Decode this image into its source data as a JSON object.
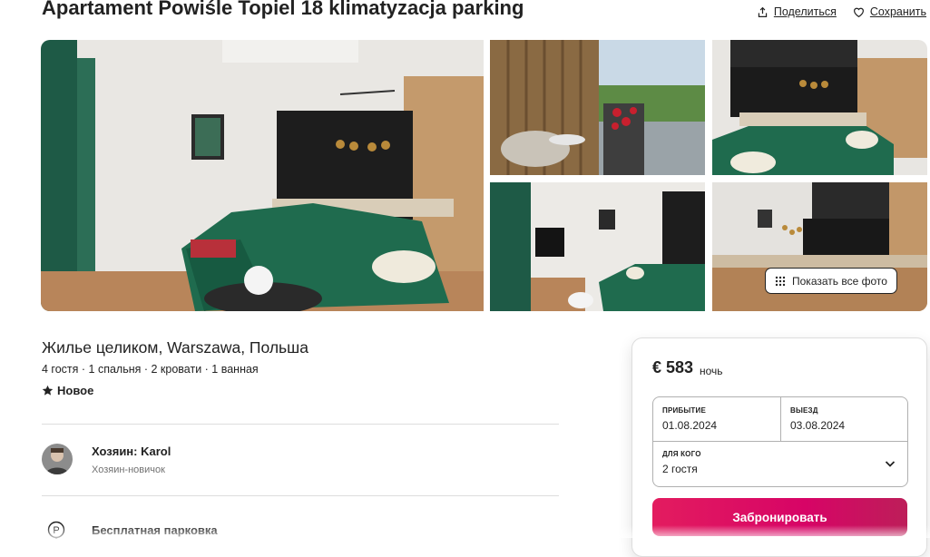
{
  "listing": {
    "title": "Apartament Powiśle Topiel 18 klimatyzacja parking",
    "share_label": "Поделиться",
    "save_label": "Сохранить"
  },
  "gallery": {
    "show_all_label": "Показать все фото"
  },
  "details": {
    "subtitle": "Жилье целиком, Warszawa, Польша",
    "specs": "4 гостя · 1 спальня · 2 кровати · 1 ванная",
    "rating_label": "Новое"
  },
  "host": {
    "name": "Хозяин: Karol",
    "subtitle": "Хозяин-новичок"
  },
  "amenities": [
    {
      "icon": "parking-icon",
      "label": "Бесплатная парковка"
    }
  ],
  "booking": {
    "price": "€ 583",
    "per_night": "ночь",
    "checkin_label": "ПРИБЫТИЕ",
    "checkin_value": "01.08.2024",
    "checkout_label": "ВЫЕЗД",
    "checkout_value": "03.08.2024",
    "guests_label": "ДЛЯ КОГО",
    "guests_value": "2 гостя",
    "reserve_label": "Забронировать"
  },
  "colors": {
    "brand": "#e31c5f",
    "text": "#222222",
    "muted": "#717171",
    "border": "#dddddd",
    "sofa_green": "#1f6b4e"
  }
}
